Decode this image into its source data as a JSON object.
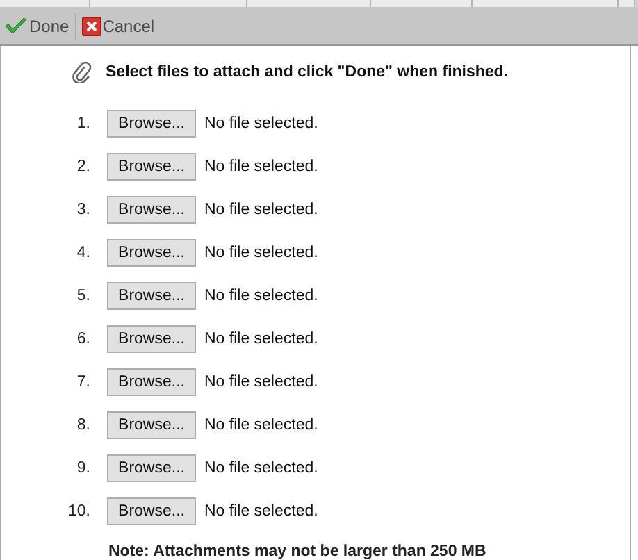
{
  "toolbar": {
    "buttons": [
      {
        "kind": "done",
        "label": "Done"
      },
      {
        "kind": "cancel",
        "label": "Cancel"
      }
    ]
  },
  "instructions": "Select files to attach and click \"Done\" when finished.",
  "files": [
    {
      "number": "1.",
      "button": "Browse...",
      "status": "No file selected."
    },
    {
      "number": "2.",
      "button": "Browse...",
      "status": "No file selected."
    },
    {
      "number": "3.",
      "button": "Browse...",
      "status": "No file selected."
    },
    {
      "number": "4.",
      "button": "Browse...",
      "status": "No file selected."
    },
    {
      "number": "5.",
      "button": "Browse...",
      "status": "No file selected."
    },
    {
      "number": "6.",
      "button": "Browse...",
      "status": "No file selected."
    },
    {
      "number": "7.",
      "button": "Browse...",
      "status": "No file selected."
    },
    {
      "number": "8.",
      "button": "Browse...",
      "status": "No file selected."
    },
    {
      "number": "9.",
      "button": "Browse...",
      "status": "No file selected."
    },
    {
      "number": "10.",
      "button": "Browse...",
      "status": "No file selected."
    }
  ],
  "note": "**Note:** Attachments may not be larger than 250 MB"
}
